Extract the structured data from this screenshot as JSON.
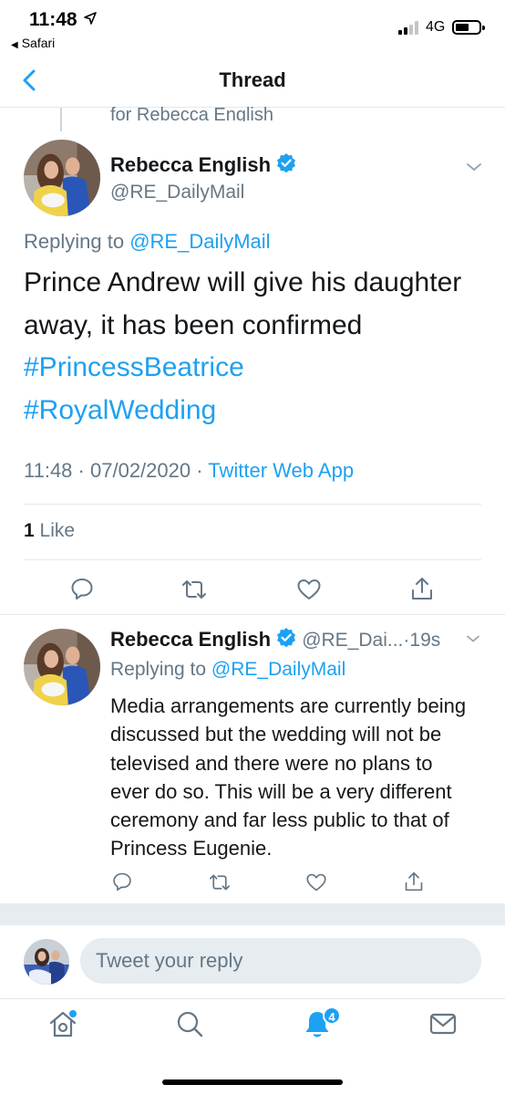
{
  "status_bar": {
    "time": "11:48",
    "back_app": "Safari",
    "network": "4G"
  },
  "header": {
    "title": "Thread"
  },
  "thread_context": {
    "text": "for Rebecca English"
  },
  "main_tweet": {
    "display_name": "Rebecca English",
    "handle": "@RE_DailyMail",
    "replying_prefix": "Replying to",
    "replying_to": "@RE_DailyMail",
    "text_plain": "Prince Andrew will give his daughter away, it has been confirmed",
    "hashtags": [
      "#PrincessBeatrice",
      "#RoyalWedding"
    ],
    "time": "11:48",
    "date": "07/02/2020",
    "source": "Twitter Web App",
    "likes_count": "1",
    "likes_label": "Like"
  },
  "reply_tweet": {
    "display_name": "Rebecca English",
    "handle": "@RE_Dai...",
    "age": "19s",
    "replying_prefix": "Replying to",
    "replying_to": "@RE_DailyMail",
    "text": "Media arrangements are currently being discussed but the wedding will not be televised and there were no plans to ever do so. This will be a very different ceremony and far less public to that of Princess Eugenie."
  },
  "composer": {
    "placeholder": "Tweet your reply"
  },
  "tabbar": {
    "notifications_badge": "4"
  },
  "colors": {
    "accent": "#1da1f2",
    "secondary_text": "#657786",
    "primary_text": "#14171a",
    "divider": "#e1e8ed"
  },
  "icons": {
    "header_back": "chevron-left-icon",
    "verified": "verified-badge-icon",
    "more": "chevron-down-icon",
    "reply": "reply-icon",
    "retweet": "retweet-icon",
    "like": "heart-icon",
    "share": "share-icon",
    "home": "home-icon",
    "search": "search-icon",
    "notifications": "bell-icon",
    "messages": "mail-icon"
  }
}
